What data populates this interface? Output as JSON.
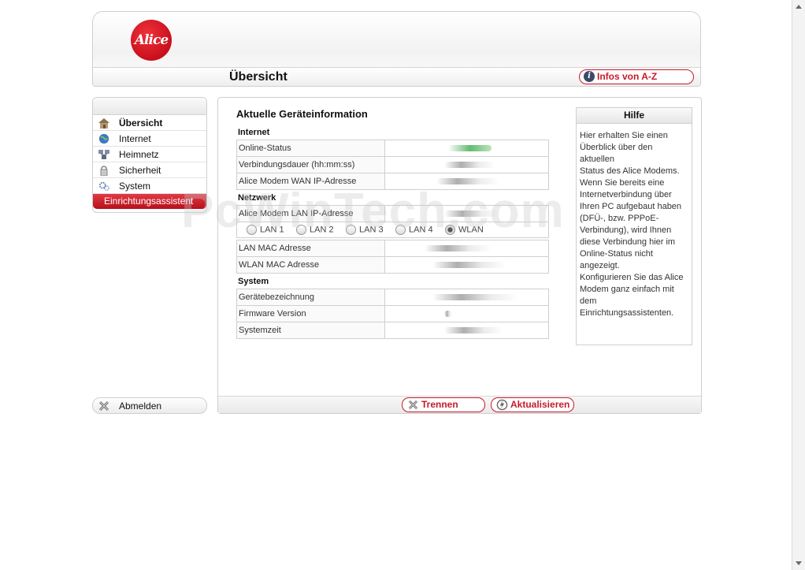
{
  "header": {
    "logo_text": "Alice",
    "page_title": "Übersicht",
    "infos_label": "Infos von A-Z"
  },
  "sidebar": {
    "items": [
      {
        "label": "Übersicht"
      },
      {
        "label": "Internet"
      },
      {
        "label": "Heimnetz"
      },
      {
        "label": "Sicherheit"
      },
      {
        "label": "System"
      }
    ],
    "assistant_label": "Einrichtungsassistent",
    "logout_label": "Abmelden"
  },
  "main": {
    "title": "Aktuelle Geräteinformation",
    "internet": {
      "title": "Internet",
      "rows": [
        "Online-Status",
        "Verbindungsdauer (hh:mm:ss)",
        "Alice Modem WAN IP-Adresse"
      ]
    },
    "network": {
      "title": "Netzwerk",
      "lan_ip_label": "Alice Modem LAN IP-Adresse",
      "ports": [
        "LAN 1",
        "LAN 2",
        "LAN 3",
        "LAN 4",
        "WLAN"
      ],
      "rows": [
        "LAN MAC Adresse",
        "WLAN MAC Adresse"
      ]
    },
    "system": {
      "title": "System",
      "rows": [
        "Gerätebezeichnung",
        "Firmware Version",
        "Systemzeit"
      ]
    },
    "buttons": {
      "disconnect": "Trennen",
      "refresh": "Aktualisieren"
    }
  },
  "help": {
    "title": "Hilfe",
    "text": "Hier erhalten Sie einen\nÜberblick über den aktuellen\nStatus des Alice Modems.\nWenn Sie bereits eine\nInternetverbindung über\nIhren PC aufgebaut haben\n(DFÜ-, bzw. PPPoE-\nVerbindung), wird Ihnen\ndiese Verbindung hier im\nOnline-Status nicht\nangezeigt.\nKonfigurieren Sie das Alice\nModem ganz einfach mit\ndem\nEinrichtungsassistenten."
  },
  "watermark": "PcWinTech.com",
  "colors": {
    "accent": "#c41a2b",
    "border": "#cfcfcf"
  }
}
